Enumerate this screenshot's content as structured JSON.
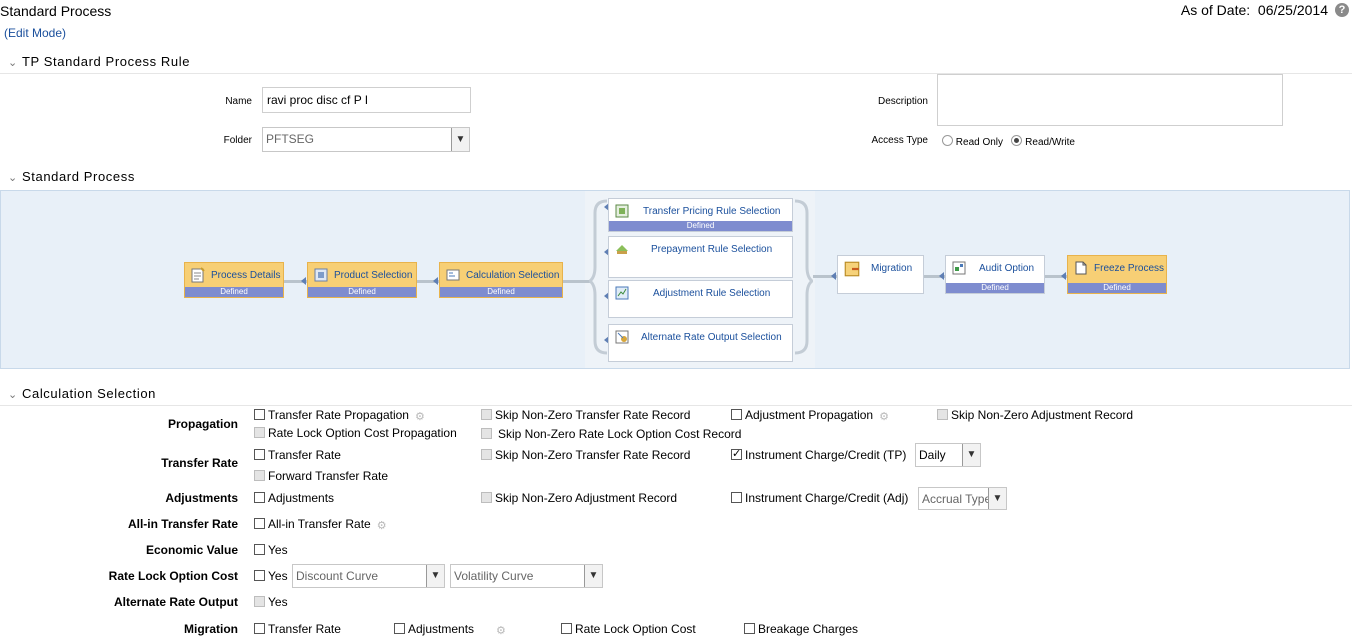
{
  "header": {
    "title": "Standard Process",
    "mode": "(Edit Mode)",
    "as_of_label": "As of Date:",
    "as_of_value": "06/25/2014",
    "help": "?"
  },
  "sections": {
    "rule": "TP Standard Process Rule",
    "process": "Standard Process",
    "calc": "Calculation Selection"
  },
  "rule_form": {
    "name_label": "Name",
    "name_value": "ravi proc disc cf P I",
    "folder_label": "Folder",
    "folder_value": "PFTSEG",
    "description_label": "Description",
    "description_value": "",
    "access_label": "Access Type",
    "access_options": [
      "Read Only",
      "Read/Write"
    ],
    "access_selected": "Read/Write"
  },
  "flow": {
    "nodes": [
      {
        "id": "process-details",
        "label": "Process Details",
        "status": "Defined",
        "highlight": true
      },
      {
        "id": "product-selection",
        "label": "Product Selection",
        "status": "Defined",
        "highlight": true
      },
      {
        "id": "calculation-selection",
        "label": "Calculation Selection",
        "status": "Defined",
        "highlight": true
      },
      {
        "id": "tp-rule-selection",
        "label": "Transfer Pricing Rule Selection",
        "status": "Defined",
        "highlight": false
      },
      {
        "id": "prepayment-rule-selection",
        "label": "Prepayment Rule Selection",
        "status": "",
        "highlight": false
      },
      {
        "id": "adjustment-rule-selection",
        "label": "Adjustment Rule Selection",
        "status": "",
        "highlight": false
      },
      {
        "id": "alt-rate-output-selection",
        "label": "Alternate Rate Output Selection",
        "status": "",
        "highlight": false
      },
      {
        "id": "migration",
        "label": "Migration",
        "status": "",
        "highlight": false
      },
      {
        "id": "audit-option",
        "label": "Audit Option",
        "status": "Defined",
        "highlight": false
      },
      {
        "id": "freeze-process",
        "label": "Freeze Process",
        "status": "Defined",
        "highlight": true
      }
    ]
  },
  "calc": {
    "propagation_label": "Propagation",
    "prop_transfer_rate": "Transfer Rate Propagation",
    "prop_skip_tr": "Skip Non-Zero Transfer Rate Record",
    "prop_adjustment": "Adjustment Propagation",
    "prop_skip_adj": "Skip Non-Zero Adjustment Record",
    "prop_rate_lock": "Rate Lock Option Cost Propagation",
    "prop_skip_rate_lock": "Skip Non-Zero Rate Lock Option Cost Record",
    "transfer_rate_label": "Transfer Rate",
    "tr_transfer_rate": "Transfer Rate",
    "tr_skip": "Skip Non-Zero Transfer Rate Record",
    "tr_instrument": "Instrument Charge/Credit (TP)",
    "tr_freq": "Daily",
    "tr_forward": "Forward Transfer Rate",
    "adjustments_label": "Adjustments",
    "adj_adjustments": "Adjustments",
    "adj_skip": "Skip Non-Zero Adjustment Record",
    "adj_instrument": "Instrument Charge/Credit (Adj)",
    "adj_accrual": "Accrual Type",
    "allin_label": "All-in Transfer Rate",
    "allin_opt": "All-in Transfer Rate",
    "econ_label": "Economic Value",
    "econ_opt": "Yes",
    "rate_lock_label": "Rate Lock Option Cost",
    "rate_lock_opt": "Yes",
    "rate_lock_discount": "Discount Curve",
    "rate_lock_volatility": "Volatility Curve",
    "alt_rate_label": "Alternate Rate Output",
    "alt_rate_opt": "Yes",
    "migration_label": "Migration",
    "mig_transfer_rate": "Transfer Rate",
    "mig_adjustments": "Adjustments",
    "mig_rate_lock": "Rate Lock Option Cost",
    "mig_breakage": "Breakage Charges"
  }
}
